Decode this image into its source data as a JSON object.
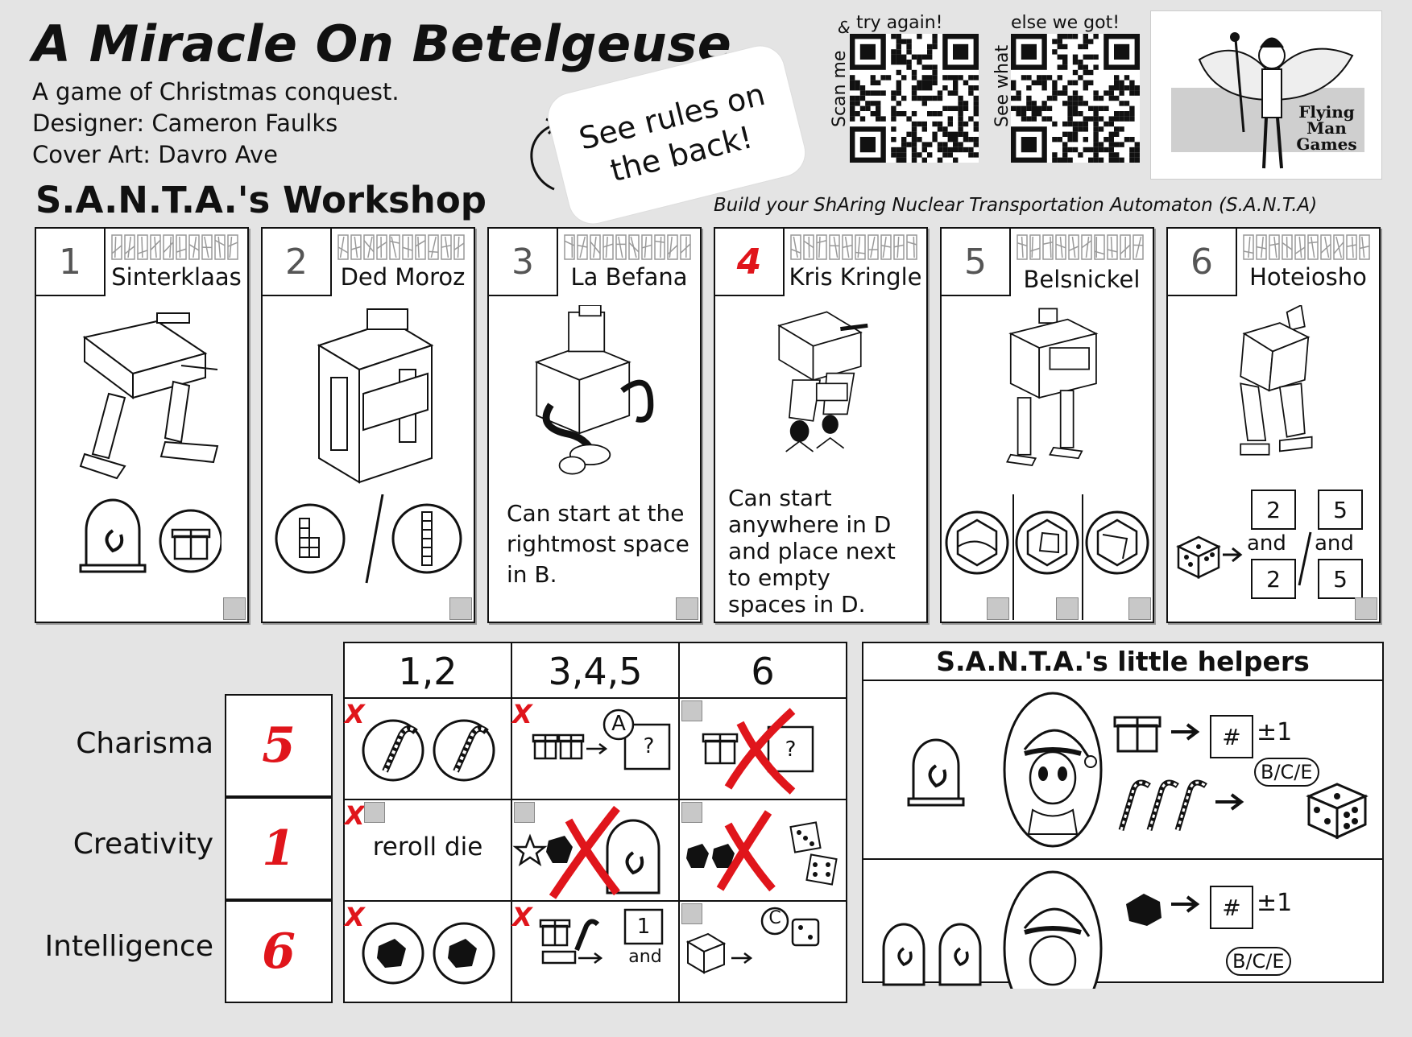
{
  "header": {
    "title": "A Miracle On Betelgeuse",
    "subtitle": "A game of Christmas conquest.",
    "designer": "Designer: Cameron Faulks",
    "cover_art": "Cover Art: Davro Ave",
    "rules_callout": "See rules on\nthe back!",
    "qr1": {
      "top": "try again!",
      "side": "Scan me",
      "amp": "&"
    },
    "qr2": {
      "top": "else we got!",
      "side": "See what"
    },
    "logo": "Flying\nMan\nGames"
  },
  "workshop": {
    "title": "S.A.N.T.A.'s Workshop",
    "subtitle": "Build your ShAring Nuclear Transportation Automaton (S.A.N.T.A)",
    "cards": [
      {
        "num": "1",
        "name": "Sinterklaas",
        "desc": ""
      },
      {
        "num": "2",
        "name": "Ded Moroz",
        "desc": ""
      },
      {
        "num": "3",
        "name": "La Befana",
        "desc": "Can start at the rightmost space in B."
      },
      {
        "num": "4",
        "name": "Kris Kringle",
        "desc": "Can start anywhere in D and place next to empty spaces in D.",
        "num_marked": true
      },
      {
        "num": "5",
        "name": "Belsnickel",
        "desc": ""
      },
      {
        "num": "6",
        "name": "Hoteiosho",
        "desc": "",
        "dice_rule": {
          "a_top": "2",
          "a_bottom": "2",
          "b_top": "5",
          "b_bottom": "5",
          "joiner": "and"
        }
      }
    ]
  },
  "stats": {
    "columns": [
      "1,2",
      "3,4,5",
      "6"
    ],
    "rows": [
      {
        "label": "Charisma",
        "value": "5",
        "cells": [
          "",
          "",
          ""
        ]
      },
      {
        "label": "Creativity",
        "value": "1",
        "cells": [
          "reroll die",
          "",
          ""
        ]
      },
      {
        "label": "Intelligence",
        "value": "6",
        "cells": [
          "",
          "",
          ""
        ]
      }
    ],
    "mark": "X",
    "letter_a": "A",
    "letter_c": "C",
    "box_q": "?",
    "box_1": "1",
    "and": "and"
  },
  "helpers": {
    "title": "S.A.N.T.A.'s little helpers",
    "row1": {
      "box": "#",
      "pm": "±1",
      "pill": "B/C/E"
    },
    "row2": {
      "box": "#",
      "pm": "±1",
      "pill": "B/C/E"
    }
  },
  "colors": {
    "accent_red": "#e0151b",
    "background": "#e4e4e4"
  }
}
